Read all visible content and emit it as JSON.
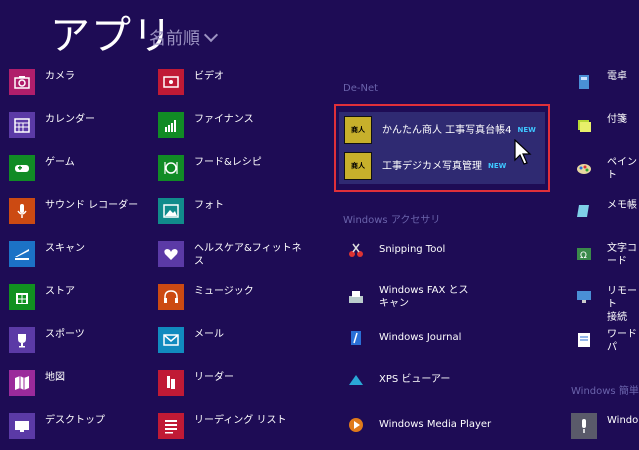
{
  "header": {
    "title": "アプリ",
    "sort_label": "名前順"
  },
  "col1": [
    {
      "label": "カメラ",
      "color": "#b01e6b",
      "icon": "camera-icon"
    },
    {
      "label": "カレンダー",
      "color": "#5b3aa6",
      "icon": "calendar-icon"
    },
    {
      "label": "ゲーム",
      "color": "#118b25",
      "icon": "gamepad-icon"
    },
    {
      "label": "サウンド レコーダー",
      "color": "#cc4a12",
      "icon": "microphone-icon"
    },
    {
      "label": "スキャン",
      "color": "#1c72c6",
      "icon": "scanner-icon"
    },
    {
      "label": "ストア",
      "color": "#119020",
      "icon": "store-icon"
    },
    {
      "label": "スポーツ",
      "color": "#5b3aa6",
      "icon": "trophy-icon"
    },
    {
      "label": "地図",
      "color": "#9b2a9b",
      "icon": "map-icon"
    },
    {
      "label": "デスクトップ",
      "color": "#5b3aa6",
      "icon": "desktop-icon"
    }
  ],
  "col2": [
    {
      "label": "ビデオ",
      "color": "#c01a35",
      "icon": "video-icon"
    },
    {
      "label": "ファイナンス",
      "color": "#118b25",
      "icon": "finance-icon"
    },
    {
      "label": "フード&レシピ",
      "color": "#118b25",
      "icon": "food-icon"
    },
    {
      "label": "フォト",
      "color": "#118b8b",
      "icon": "photo-icon"
    },
    {
      "label": "ヘルスケア&フィットネ\nス",
      "color": "#5b3aa6",
      "icon": "heart-icon"
    },
    {
      "label": "ミュージック",
      "color": "#cc4a12",
      "icon": "headphones-icon"
    },
    {
      "label": "メール",
      "color": "#118bbf",
      "icon": "mail-icon"
    },
    {
      "label": "リーダー",
      "color": "#c01a35",
      "icon": "reader-icon"
    },
    {
      "label": "リーディング リスト",
      "color": "#c01a35",
      "icon": "reading-list-icon"
    }
  ],
  "col3_groups": {
    "denet": "De-Net",
    "accessories": "Windows アクセサリ"
  },
  "highlighted": [
    {
      "label": "かんたん商人 工事写真台帳4",
      "badge": "NEW",
      "tile_text": "商人"
    },
    {
      "label": "工事デジカメ写真管理",
      "badge": "NEW",
      "tile_text": "商人"
    }
  ],
  "col3": [
    {
      "label": "Snipping Tool",
      "icon": "snipping-tool-icon"
    },
    {
      "label": "Windows FAX とス\nキャン",
      "icon": "fax-icon"
    },
    {
      "label": "Windows Journal",
      "icon": "journal-icon"
    },
    {
      "label": "XPS ビューアー",
      "icon": "xps-viewer-icon"
    },
    {
      "label": "Windows Media Player",
      "icon": "media-player-icon"
    }
  ],
  "col4": [
    {
      "label": "電卓",
      "icon": "calculator-icon"
    },
    {
      "label": "付箋",
      "icon": "sticky-notes-icon"
    },
    {
      "label": "ペイント",
      "icon": "paint-icon"
    },
    {
      "label": "メモ帳",
      "icon": "notepad-icon"
    },
    {
      "label": "文字コード",
      "icon": "charmap-icon"
    },
    {
      "label": "リモート\n接続",
      "icon": "remote-desktop-icon"
    },
    {
      "label": "ワードパ",
      "icon": "wordpad-icon"
    }
  ],
  "col4_group": "Windows 簡単",
  "col4_last": {
    "label": "Windo",
    "icon": "microphone-icon"
  }
}
